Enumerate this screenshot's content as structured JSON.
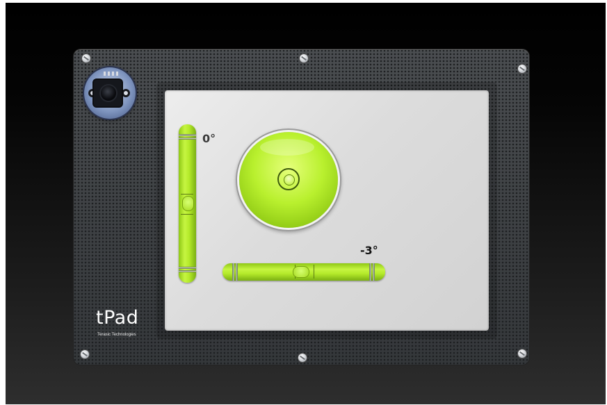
{
  "device": {
    "brand": "tPad",
    "manufacturer": "Terasic Technologies"
  },
  "level_app": {
    "vertical_tube": {
      "angle_label": "0°",
      "bubble_position": 0.5
    },
    "horizontal_tube": {
      "angle_label": "-3°",
      "bubble_position": 0.48
    },
    "bullseye": {
      "bubble_offset_x": 0.02,
      "bubble_offset_y": 0.0
    }
  },
  "icons": [
    "screw-icon",
    "camera-icon"
  ],
  "colors": {
    "level_green": "#b4ea2a",
    "screen": "#e0e0e0",
    "panel": "#3a3d40"
  }
}
